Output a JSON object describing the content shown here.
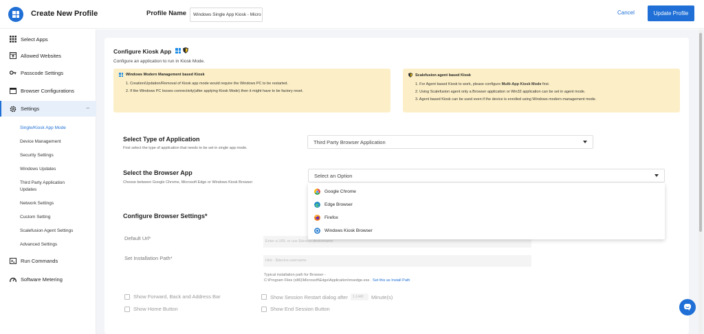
{
  "header": {
    "title": "Create New Profile",
    "profile_name_label": "Profile Name",
    "profile_name_value": "Windows Single App Kiosk - Micro",
    "cancel_label": "Cancel",
    "update_label": "Update Profile"
  },
  "sidebar": {
    "items": [
      {
        "label": "Select Apps",
        "icon": "grid-icon"
      },
      {
        "label": "Allowed Websites",
        "icon": "browser-window-icon"
      },
      {
        "label": "Passcode Settings",
        "icon": "key-icon"
      },
      {
        "label": "Browser Configurations",
        "icon": "browser-icon"
      },
      {
        "label": "Settings",
        "icon": "gear-icon"
      },
      {
        "label": "Run Commands",
        "icon": "terminal-icon"
      },
      {
        "label": "Software Metering",
        "icon": "gauge-icon"
      }
    ],
    "settings_collapse": "–",
    "sub_items": [
      "Single/Kiosk App Mode",
      "Device Management",
      "Security Settings",
      "Windows Updates",
      "Third Party Application Updates",
      "Network Settings",
      "Custom Setting",
      "Scalefusion Agent Settings",
      "Advanced Settings"
    ]
  },
  "main": {
    "title": "Configure Kiosk App",
    "subtitle": "Configure an application to run in Kiosk Mode.",
    "info_left": {
      "heading": "Windows Modern Management based Kiosk",
      "lines": [
        "1. Creation/Updation/Removal of Kiosk app mode would require the Windows PC to be restarted.",
        "2. If the Windows PC looses connectivity(after applying Kiosk Mode) then it might have to be factory reset."
      ]
    },
    "info_right": {
      "heading": "Scalefusion agent based Kiosk",
      "line1_pre": "1. For Agent based Kiosk to work, please configure ",
      "line1_bold": "Multi-App Kiosk Mode",
      "line1_post": " first.",
      "line2": "2. Using Scalefusion agent only a Browser application or Win32 application can be set in agent mode.",
      "line3": "3. Agent based Kiosk can be used even if the device is enrolled using Windows modern management mode."
    },
    "app_type": {
      "title": "Select Type of Application",
      "desc": "First select the type of application that needs to be set in single app mode.",
      "value": "Third Party Browser Application"
    },
    "browser_app": {
      "title": "Select the Browser App",
      "desc": "Choose between Google Chrome, Microsoft Edge or Windows Kiosk Browser",
      "placeholder": "Select an Option",
      "options": [
        "Google Chrome",
        "Edge Browser",
        "Firefox",
        "Windows Kiosk Browser"
      ],
      "option_colors": [
        "#e8453c",
        "#1e88c8",
        "#f07a1a",
        "#2a7fd1"
      ]
    },
    "browser_settings": {
      "title": "Configure Browser Settings*",
      "default_url_label": "Default Url*",
      "default_url_placeholder": "Enter a URL or use $device.devicename",
      "install_path_label": "Set Installation Path*",
      "install_path_placeholder": "Hint - $device.username",
      "hint_line1": "Typical installation path for Browser -",
      "hint_line2": "C:\\Program Files (x86)\\Microsoft\\Edge\\Application\\msedge.exe . ",
      "hint_link": "Set this as Install Path",
      "chk_forward": "Show Forward, Back and Address Bar",
      "chk_home": "Show Home Button",
      "chk_restart_pre": "Show Session Restart dialog after",
      "chk_restart_value": "1-1440",
      "chk_restart_post": "Minute(s)",
      "chk_end": "Show End Session Button"
    }
  }
}
